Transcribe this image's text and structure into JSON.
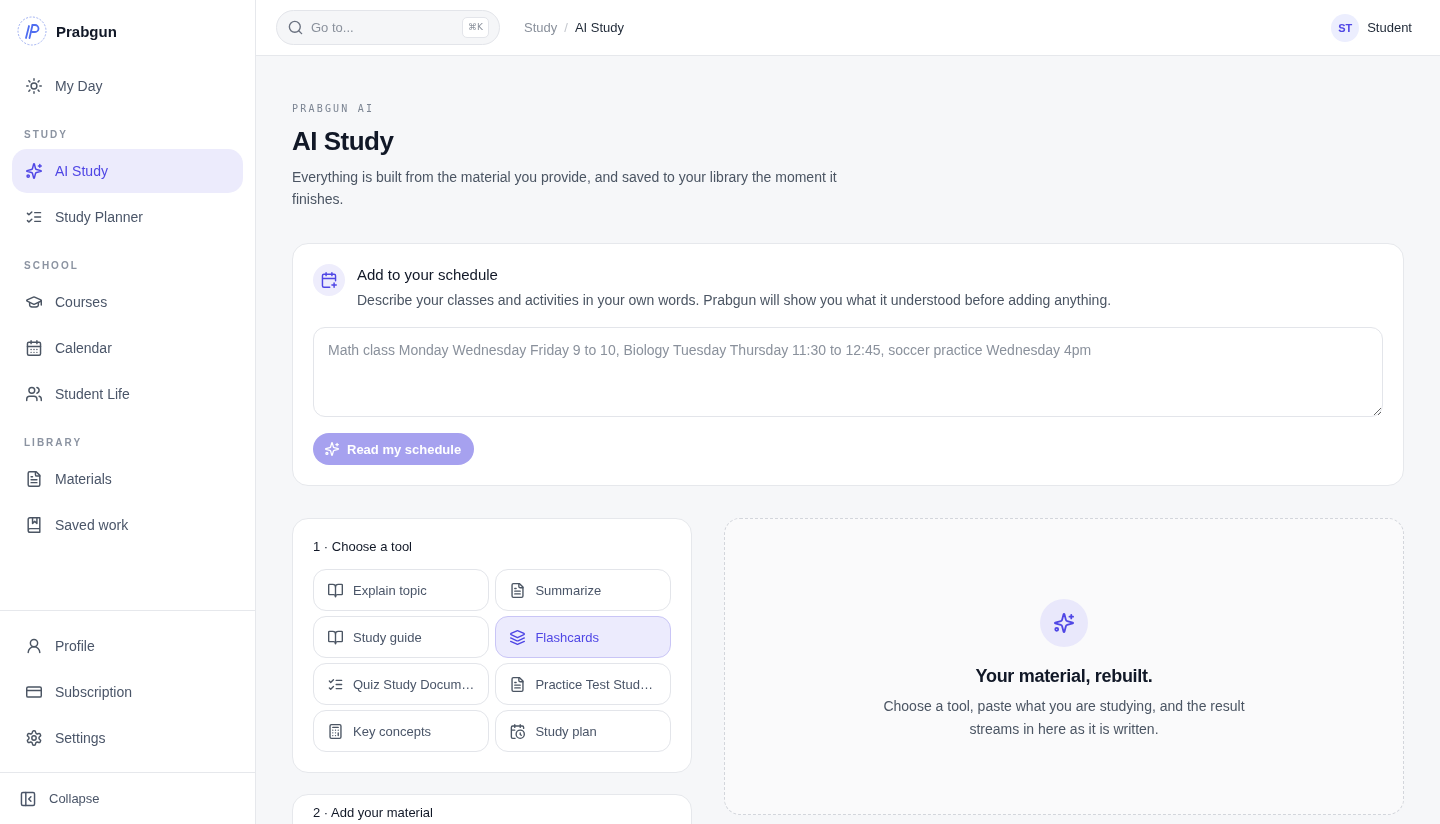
{
  "sidebar": {
    "brand": "Prabgun",
    "sections": [
      {
        "items": [
          {
            "label": "My Day",
            "selected": false
          }
        ]
      },
      {
        "heading": "STUDY",
        "items": [
          {
            "label": "AI Study",
            "selected": true
          },
          {
            "label": "Study Planner",
            "selected": false
          }
        ]
      },
      {
        "heading": "SCHOOL",
        "items": [
          {
            "label": "Courses",
            "selected": false
          },
          {
            "label": "Calendar",
            "selected": false
          },
          {
            "label": "Student Life",
            "selected": false
          }
        ]
      },
      {
        "heading": "LIBRARY",
        "items": [
          {
            "label": "Materials",
            "selected": false
          },
          {
            "label": "Saved work",
            "selected": false
          }
        ]
      }
    ],
    "footer_items": [
      {
        "label": "Profile",
        "selected": false
      },
      {
        "label": "Subscription",
        "selected": false
      },
      {
        "label": "Settings",
        "selected": false
      }
    ],
    "collapse": "Collapse"
  },
  "topbar": {
    "search": {
      "placeholder": "Go to...",
      "shortcut": "⌘K"
    },
    "breadcrumb": {
      "separator": "/",
      "items": [
        {
          "label": "Study",
          "current": false
        },
        {
          "label": "AI Study",
          "current": true
        }
      ]
    },
    "user": {
      "initials": "ST",
      "name": "Student"
    }
  },
  "page": {
    "eyebrow": "PRABGUN AI",
    "title": "AI Study",
    "description": "Everything is built from the material you provide, and saved to your library the moment it finishes."
  },
  "schedule_card": {
    "title": "Add to your schedule",
    "description": "Describe your classes and activities in your own words. Prabgun will show you what it understood before adding anything.",
    "input": {
      "placeholder": "Math class Monday Wednesday Friday 9 to 10, Biology Tuesday Thursday 11:30 to 12:45, soccer practice Wednesday 4pm"
    },
    "button": {
      "label": "Read my schedule",
      "disabled": true
    }
  },
  "tool_picker": {
    "heading": "1 · Choose a tool",
    "tools": [
      {
        "label": "Explain topic",
        "selected": false
      },
      {
        "label": "Summarize",
        "selected": false
      },
      {
        "label": "Study guide",
        "selected": false
      },
      {
        "label": "Flashcards",
        "selected": true
      },
      {
        "label": "Quiz Study Docum…",
        "selected": false
      },
      {
        "label": "Practice Test Stud…",
        "selected": false
      },
      {
        "label": "Key concepts",
        "selected": false
      },
      {
        "label": "Study plan",
        "selected": false
      }
    ]
  },
  "material_card": {
    "heading": "2 · Add your material"
  },
  "result_panel": {
    "title": "Your material, rebuilt.",
    "description": "Choose a tool, paste what you are studying, and the result streams in here as it is written."
  }
}
